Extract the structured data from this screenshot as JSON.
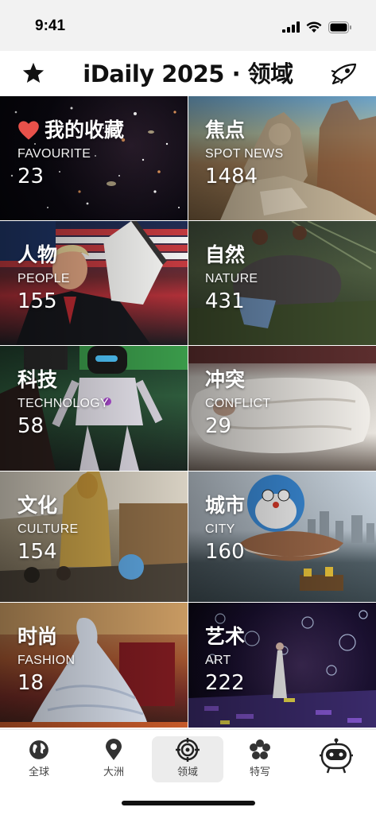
{
  "status_bar": {
    "time": "9:41"
  },
  "header": {
    "title": "iDaily 2025 · 领域",
    "left_icon": "star-icon",
    "right_icon": "spaceship-icon"
  },
  "categories": [
    {
      "zh": "我的收藏",
      "en": "FAVOURITE",
      "count": "23",
      "icon": "heart-icon",
      "accent": "#e8514a"
    },
    {
      "zh": "焦点",
      "en": "SPOT NEWS",
      "count": "1484"
    },
    {
      "zh": "人物",
      "en": "PEOPLE",
      "count": "155"
    },
    {
      "zh": "自然",
      "en": "NATURE",
      "count": "431"
    },
    {
      "zh": "科技",
      "en": "TECHNOLOGY",
      "count": "58"
    },
    {
      "zh": "冲突",
      "en": "CONFLICT",
      "count": "29"
    },
    {
      "zh": "文化",
      "en": "CULTURE",
      "count": "154"
    },
    {
      "zh": "城市",
      "en": "CITY",
      "count": "160"
    },
    {
      "zh": "时尚",
      "en": "FASHION",
      "count": "18"
    },
    {
      "zh": "艺术",
      "en": "ART",
      "count": "222"
    }
  ],
  "tabbar": {
    "tabs": [
      {
        "label": "全球",
        "icon": "globe-icon"
      },
      {
        "label": "大洲",
        "icon": "location-pin-icon"
      },
      {
        "label": "领域",
        "icon": "target-icon",
        "active": true
      },
      {
        "label": "特写",
        "icon": "flower-icon"
      },
      {
        "label": "",
        "icon": "robot-mascot-icon"
      }
    ]
  }
}
